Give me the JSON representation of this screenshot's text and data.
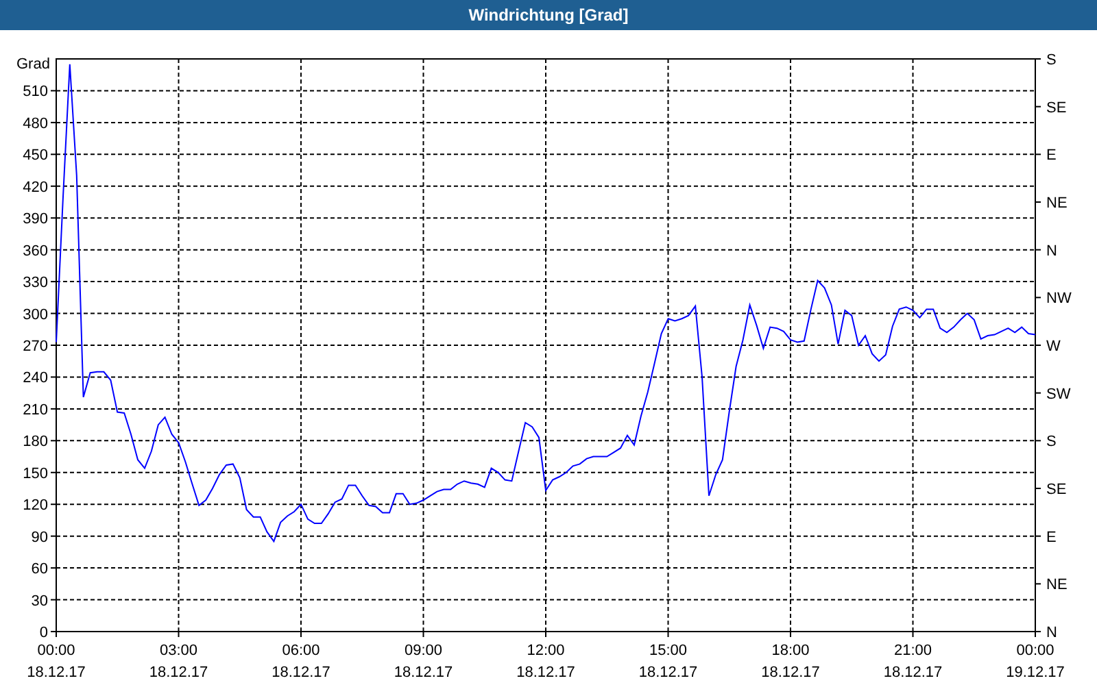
{
  "window": {
    "title": "Windrichtung [Grad]"
  },
  "chart": {
    "chart_data": {
      "type": "line",
      "ylabel": "Grad",
      "categories": [
        "00:00 18.12.17",
        null,
        null,
        null,
        null,
        null,
        null,
        null,
        null,
        null,
        null,
        null,
        null,
        null,
        null,
        null,
        null,
        null,
        "03:00 18.12.17",
        null,
        null,
        null,
        null,
        null,
        null,
        null,
        null,
        null,
        null,
        null,
        null,
        null,
        null,
        null,
        null,
        null,
        "06:00 18.12.17",
        null,
        null,
        null,
        null,
        null,
        null,
        null,
        null,
        null,
        null,
        null,
        null,
        null,
        null,
        null,
        null,
        null,
        "09:00 18.12.17",
        null,
        null,
        null,
        null,
        null,
        null,
        null,
        null,
        null,
        null,
        null,
        null,
        null,
        null,
        null,
        null,
        null,
        "12:00 18.12.17",
        null,
        null,
        null,
        null,
        null,
        null,
        null,
        null,
        null,
        null,
        null,
        null,
        null,
        null,
        null,
        null,
        null,
        "15:00 18.12.17",
        null,
        null,
        null,
        null,
        null,
        null,
        null,
        null,
        null,
        null,
        null,
        null,
        null,
        null,
        null,
        null,
        null,
        "18:00 18.12.17",
        null,
        null,
        null,
        null,
        null,
        null,
        null,
        null,
        null,
        null,
        null,
        null,
        null,
        null,
        null,
        null,
        null,
        "21:00 18.12.17",
        null,
        null,
        null,
        null,
        null,
        null,
        null,
        null,
        null,
        null,
        null,
        null,
        null,
        null,
        null,
        null,
        null,
        "00:00 19.12.17"
      ],
      "series": [
        {
          "color": "#0000ff",
          "values": [
            273,
            410,
            535,
            430,
            221,
            244,
            245,
            245,
            237,
            207,
            206,
            186,
            162,
            154,
            170,
            195,
            202,
            186,
            178,
            160,
            139,
            119,
            124,
            135,
            148,
            157,
            158,
            145,
            115,
            108,
            108,
            94,
            85,
            103,
            109,
            113,
            120,
            106,
            102,
            102,
            111,
            122,
            125,
            138,
            138,
            128,
            119,
            118,
            112,
            112,
            130,
            130,
            120,
            121,
            124,
            128,
            132,
            134,
            134,
            139,
            142,
            140,
            139,
            136,
            154,
            150,
            143,
            142,
            170,
            197,
            193,
            183,
            133,
            143,
            146,
            150,
            156,
            158,
            163,
            165,
            165,
            165,
            169,
            173,
            185,
            176,
            203,
            226,
            253,
            281,
            295,
            293,
            295,
            298,
            307,
            240,
            128,
            148,
            162,
            208,
            250,
            275,
            308,
            289,
            267,
            287,
            286,
            283,
            275,
            273,
            274,
            304,
            331,
            324,
            308,
            271,
            303,
            298,
            270,
            279,
            262,
            255,
            261,
            288,
            304,
            306,
            303,
            296,
            304,
            304,
            286,
            282,
            287,
            294,
            300,
            294,
            276,
            279,
            280,
            283,
            286,
            282,
            287,
            281,
            280
          ]
        }
      ],
      "ylim": [
        0,
        540
      ],
      "grid": true,
      "yticks": [
        0,
        30,
        60,
        90,
        120,
        150,
        180,
        210,
        240,
        270,
        300,
        330,
        360,
        390,
        420,
        450,
        480,
        510
      ]
    },
    "compass_axis_labels": [
      "S",
      "SE",
      "E",
      "NE",
      "N",
      "NW",
      "W",
      "SW",
      "S",
      "SE",
      "E",
      "NE",
      "N"
    ]
  }
}
